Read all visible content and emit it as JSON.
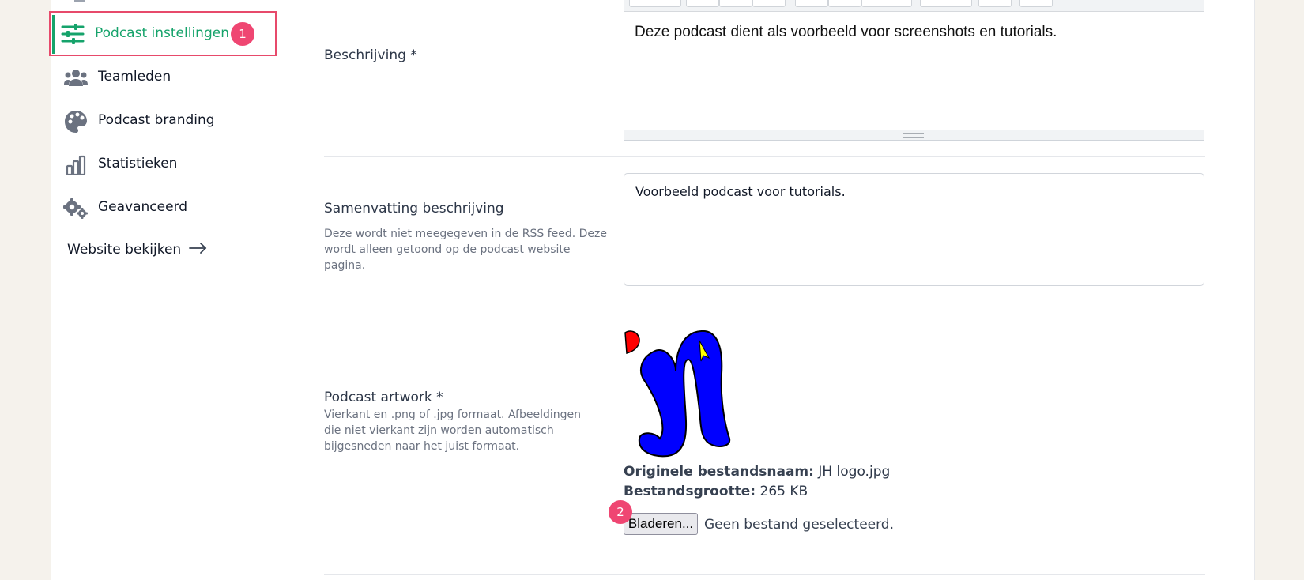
{
  "sidebar": {
    "items": [
      {
        "label": "Podcast instellingen",
        "icon": "sliders-icon",
        "active": true,
        "badge": "1"
      },
      {
        "label": "Teamleden",
        "icon": "users-icon"
      },
      {
        "label": "Podcast branding",
        "icon": "palette-icon"
      },
      {
        "label": "Statistieken",
        "icon": "bar-chart-icon"
      },
      {
        "label": "Geavanceerd",
        "icon": "gears-icon"
      }
    ],
    "website_link": "Website bekijken"
  },
  "form": {
    "description": {
      "label": "Beschrijving *",
      "value": "Deze podcast dient als voorbeeld voor screenshots en tutorials."
    },
    "summary": {
      "label": "Samenvatting beschrijving",
      "hint": "Deze wordt niet meegegeven in de RSS feed. Deze wordt alleen getoond op de podcast website pagina.",
      "value": "Voorbeeld podcast voor tutorials."
    },
    "artwork": {
      "label": "Podcast artwork *",
      "hint": "Vierkant en .png of .jpg formaat. Afbeeldingen die niet vierkant zijn worden automatisch bijgesneden naar het juist formaat.",
      "original_name_label": "Originele bestandsnaam:",
      "original_name_value": "JH logo.jpg",
      "size_label": "Bestandsgrootte:",
      "size_value": "265 KB",
      "browse_label": "Bladeren...",
      "file_status": "Geen bestand geselecteerd.",
      "badge": "2"
    }
  },
  "colors": {
    "accent": "#16a36b",
    "highlight_border": "#e74a6b",
    "badge": "#ef4672",
    "background": "#f5f2ec"
  }
}
